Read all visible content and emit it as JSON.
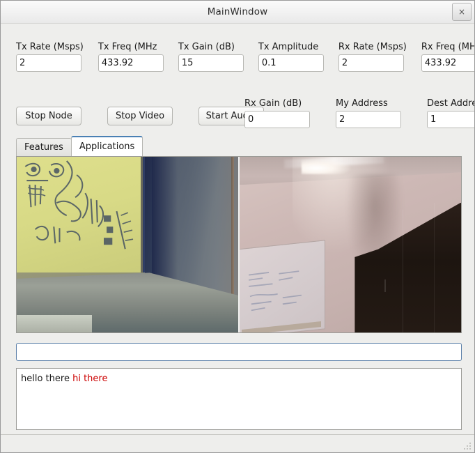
{
  "window": {
    "title": "MainWindow",
    "close_label": "×"
  },
  "params": {
    "row1": [
      {
        "label": "Tx Rate (Msps)",
        "value": "2"
      },
      {
        "label": "Tx Freq (MHz",
        "value": "433.92"
      },
      {
        "label": "Tx Gain (dB)",
        "value": "15"
      },
      {
        "label": "Tx Amplitude",
        "value": "0.1"
      },
      {
        "label": "Rx Rate (Msps)",
        "value": "2"
      },
      {
        "label": "Rx Freq (MHz)",
        "value": "433.92"
      }
    ],
    "row2": [
      {
        "label": "Rx Gain (dB)",
        "value": "0"
      },
      {
        "label": "My Address",
        "value": "2"
      },
      {
        "label": "Dest Address",
        "value": "1"
      }
    ]
  },
  "buttons": [
    {
      "label": "Stop Node"
    },
    {
      "label": "Stop Video"
    },
    {
      "label": "Start Audio"
    }
  ],
  "tabs": [
    {
      "label": "Features",
      "active": false
    },
    {
      "label": "Applications",
      "active": true
    }
  ],
  "video": {
    "left_stream_name": "local-video-feed",
    "right_stream_name": "remote-video-feed"
  },
  "message_input": {
    "value": "",
    "placeholder": ""
  },
  "chat": {
    "local_message": "hello there",
    "remote_message": "hi there"
  },
  "statusbar": {
    "text": ""
  },
  "colors": {
    "window_bg": "#eeeeec",
    "accent_tab": "#4a80b4",
    "focus_border": "#5b7fa8",
    "remote_text": "#cc0000"
  }
}
